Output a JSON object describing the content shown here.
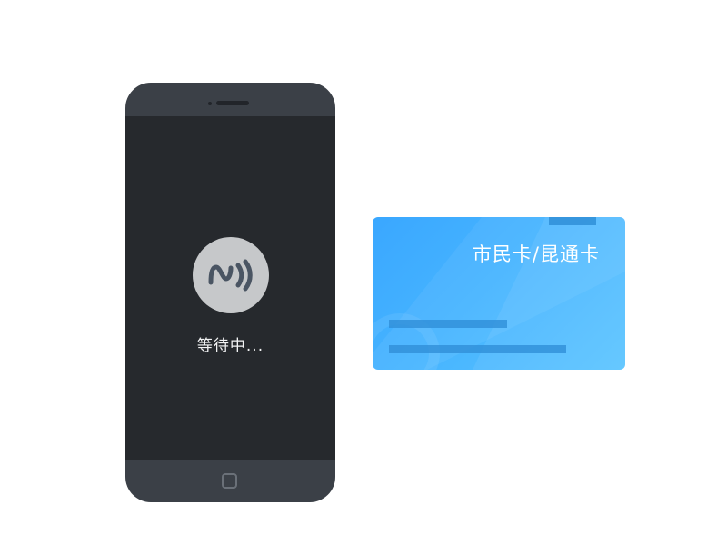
{
  "phone": {
    "status_text": "等待中...",
    "nfc_icon": "nfc-icon",
    "home_icon": "home-button-icon"
  },
  "card": {
    "title": "市民卡/昆通卡"
  },
  "colors": {
    "phone_body": "#3b4047",
    "phone_screen": "#26292d",
    "nfc_circle": "#c6c8ca",
    "nfc_glyph": "#4a5563",
    "card_start": "#3aa7ff",
    "card_end": "#5bc4ff",
    "card_stripe": "#2f8fd8"
  }
}
